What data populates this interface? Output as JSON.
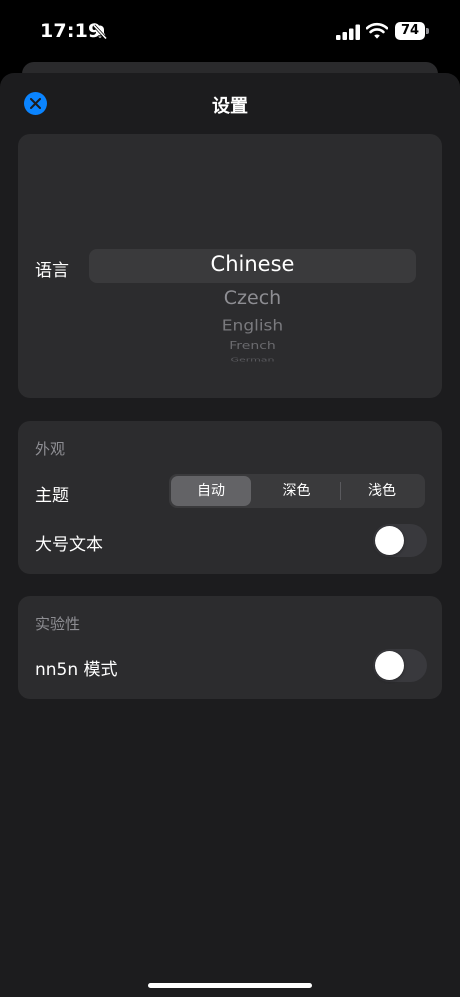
{
  "status_bar": {
    "time": "17:19",
    "battery": "74",
    "icons": [
      "bell-slash-icon",
      "cellular-signal-icon",
      "wifi-icon",
      "battery-icon"
    ]
  },
  "sheet": {
    "title": "设置",
    "close_icon": "close-icon",
    "accent": "#0a84ff"
  },
  "language": {
    "label": "语言",
    "options": [
      "Chinese",
      "Czech",
      "English",
      "French",
      "German"
    ],
    "selected": "Chinese"
  },
  "appearance": {
    "header": "外观",
    "theme_label": "主题",
    "theme_options": [
      "自动",
      "深色",
      "浅色"
    ],
    "theme_selected": "自动",
    "large_text_label": "大号文本",
    "large_text_on": false
  },
  "experimental": {
    "header": "实验性",
    "nn5n_label": "nn5n 模式",
    "nn5n_on": false
  },
  "colors": {
    "background": "#000000",
    "sheet": "#1c1c1e",
    "card": "#2c2c2e",
    "secondary_text": "#8e8e93"
  }
}
